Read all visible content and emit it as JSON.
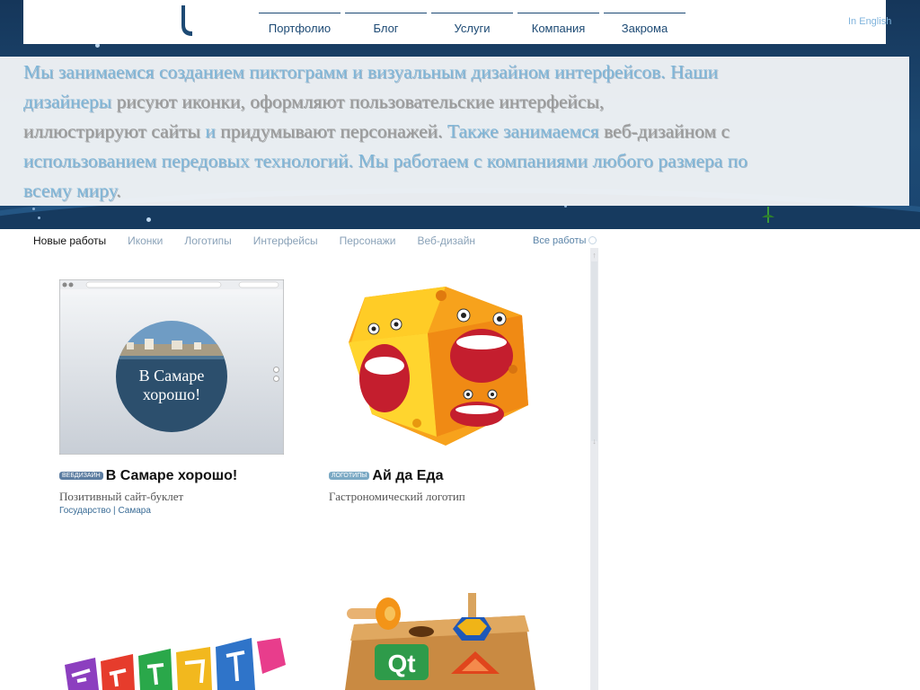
{
  "header": {
    "nav": [
      "Портфолио",
      "Блог",
      "Услуги",
      "Компания",
      "Закрома"
    ],
    "lang_link": "In English"
  },
  "intro": {
    "p1": "Мы занимаемся созданием пиктограмм и визуальным дизайном интерфейсов. Наши",
    "p2": "дизайнеры",
    "p3": " рисуют иконки, оформляют пользовательские интерфейсы,",
    "p4": "иллюстрируют сайты",
    "p5": " и ",
    "p6": "придумывают персонажей.",
    "p7": " Также занимаемся",
    "p8": " веб-дизайном с",
    "p9": "использованием передовых технологий.",
    "p10": " Мы работаем с компаниями любого размера",
    "p11": " по",
    "p12": "всему миру",
    "p13": "."
  },
  "tabs": [
    "Новые работы",
    "Иконки",
    "Логотипы",
    "Интерфейсы",
    "Персонажи",
    "Веб-дизайн"
  ],
  "all_works": "Все работы",
  "scroll_up": "↑",
  "scroll_down": "↓",
  "works": [
    {
      "badge": "вебдизайн",
      "title": "В Самаре хорошо!",
      "subtitle": "Позитивный сайт-буклет",
      "tags": [
        "Государство",
        "Самара"
      ],
      "tag_sep": " | ",
      "image_text_1": "В Самаре",
      "image_text_2": "хорошо!"
    },
    {
      "badge": "логотипы",
      "title": "Ай да Еда",
      "subtitle": "Гастрономический логотип"
    }
  ],
  "toy_letters": "Qt",
  "colors": {
    "nav": "#1d4a74",
    "highlight": "#7fb6d8",
    "band": "#1d4a74"
  }
}
